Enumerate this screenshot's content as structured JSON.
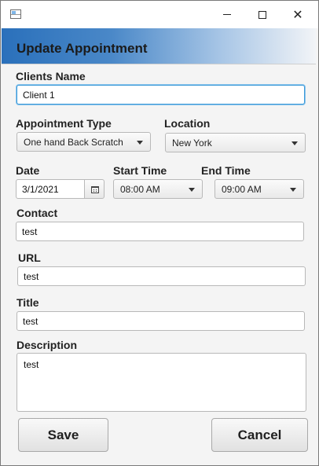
{
  "window": {
    "controls": {
      "minimize_icon": "minimize-icon",
      "maximize_icon": "maximize-icon",
      "close_icon": "close-icon",
      "close_glyph": "✕"
    }
  },
  "header": {
    "title": "Update Appointment",
    "gradient_start": "#2a70bb",
    "gradient_end": "#f2f4f7"
  },
  "form": {
    "client_name": {
      "label": "Clients Name",
      "value": "Client 1"
    },
    "appointment_type": {
      "label": "Appointment Type",
      "selected": "One hand Back Scratch"
    },
    "location": {
      "label": "Location",
      "selected": "New York"
    },
    "date": {
      "label": "Date",
      "value": "3/1/2021",
      "icon": "calendar-icon"
    },
    "start_time": {
      "label": "Start Time",
      "selected": "08:00 AM"
    },
    "end_time": {
      "label": "End Time",
      "selected": "09:00 AM"
    },
    "contact": {
      "label": "Contact",
      "value": "test"
    },
    "url": {
      "label": "URL",
      "value": "test"
    },
    "title": {
      "label": "Title",
      "value": "test"
    },
    "description": {
      "label": "Description",
      "value": "test"
    }
  },
  "actions": {
    "save_label": "Save",
    "cancel_label": "Cancel"
  },
  "colors": {
    "focus_border": "#3b9ad8",
    "window_background": "#f4f4f4"
  }
}
